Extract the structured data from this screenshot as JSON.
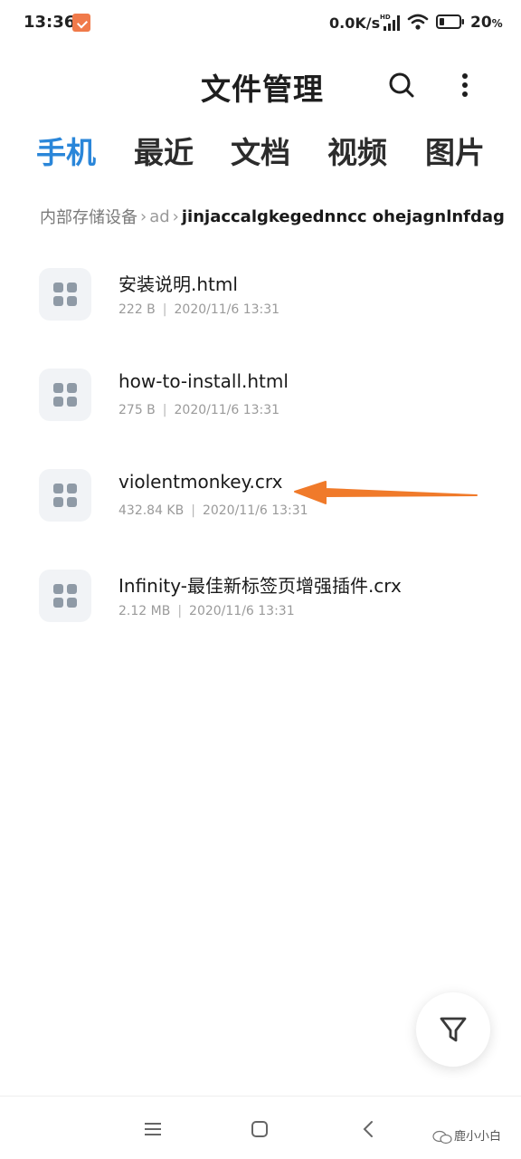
{
  "status_bar": {
    "time": "13:36",
    "network_speed": "0.0K/s",
    "battery_percent": "20",
    "battery_suffix": "%"
  },
  "header": {
    "title": "文件管理",
    "search_icon": "search-icon",
    "more_icon": "more-vertical-icon"
  },
  "tabs": [
    {
      "label": "手机",
      "active": true
    },
    {
      "label": "最近",
      "active": false
    },
    {
      "label": "文档",
      "active": false
    },
    {
      "label": "视频",
      "active": false
    },
    {
      "label": "图片",
      "active": false
    }
  ],
  "breadcrumb": {
    "root": "内部存储设备",
    "middle": "ad",
    "current": "jinjaccalgkegednncc ohejagnlnfdag"
  },
  "files": [
    {
      "name": "安装说明.html",
      "size": "222 B",
      "date": "2020/11/6 13:31"
    },
    {
      "name": "how-to-install.html",
      "size": "275 B",
      "date": "2020/11/6 13:31"
    },
    {
      "name": "violentmonkey.crx",
      "size": "432.84 KB",
      "date": "2020/11/6 13:31"
    },
    {
      "name": "Infinity-最佳新标签页增强插件.crx",
      "size": "2.12 MB",
      "date": "2020/11/6 13:31"
    }
  ],
  "meta_separator": "|",
  "fab": {
    "icon": "filter-icon"
  },
  "watermark": "鹿小小白",
  "colors": {
    "accent": "#2a86d9",
    "arrow": "#f07a2a",
    "icon_tile": "#f1f3f6",
    "icon_glyph": "#8f9aa6"
  }
}
